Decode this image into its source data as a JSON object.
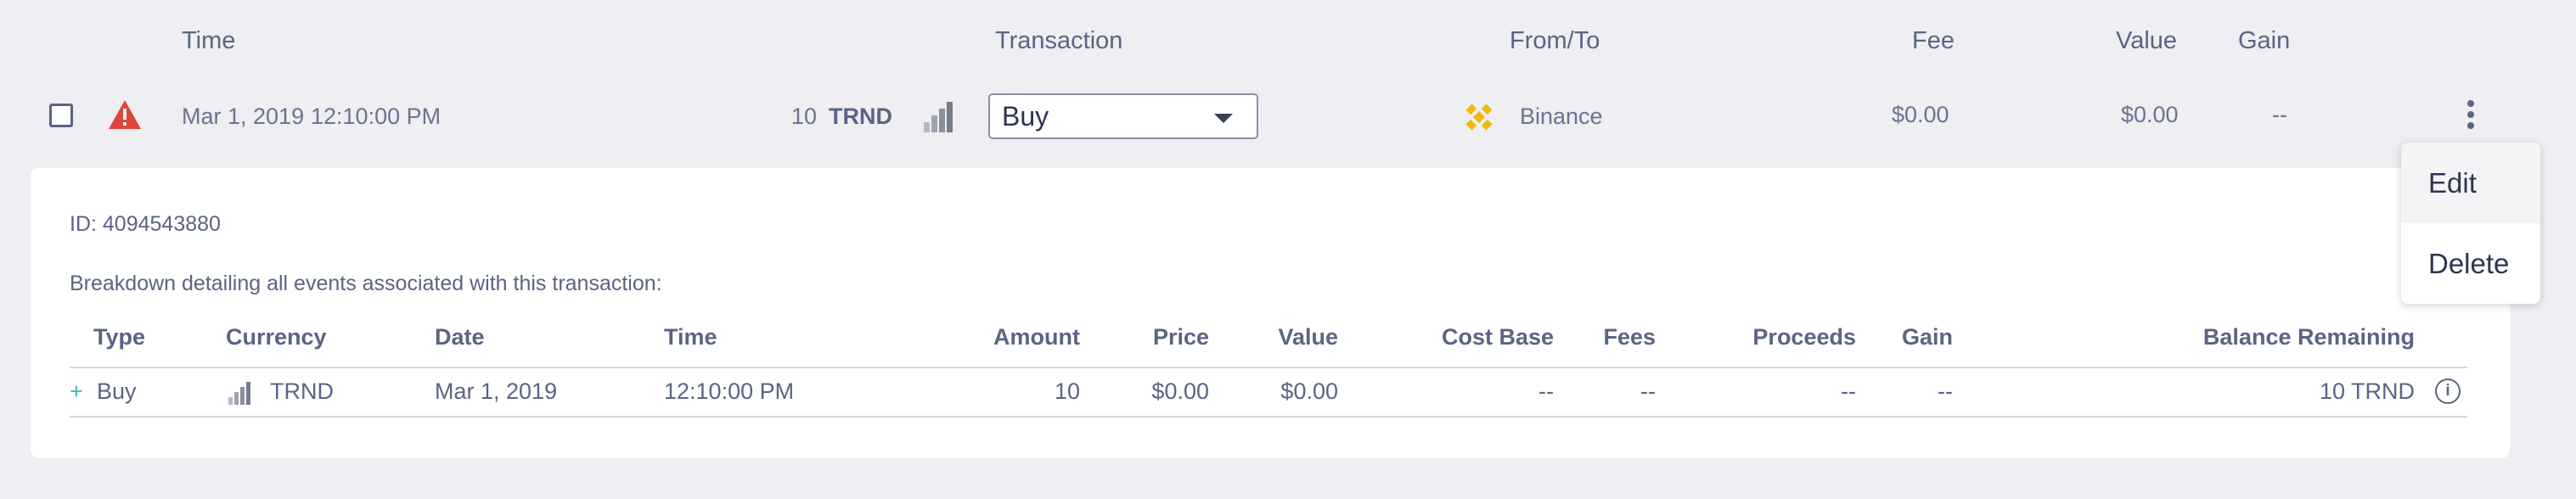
{
  "header": {
    "time": "Time",
    "transaction": "Transaction",
    "from_to": "From/To",
    "fee": "Fee",
    "value": "Value",
    "gain": "Gain"
  },
  "row": {
    "date": "Mar 1, 2019",
    "time": "12:10:00 PM",
    "amount": "10",
    "currency": "TRND",
    "transaction_type": "Buy",
    "exchange": "Binance",
    "fee": "$0.00",
    "value": "$0.00",
    "gain": "--"
  },
  "menu": {
    "edit": "Edit",
    "delete": "Delete"
  },
  "detail": {
    "id_label": "ID: 4094543880",
    "breakdown_text": "Breakdown detailing all events associated with this transaction:",
    "columns": [
      "Type",
      "Currency",
      "Date",
      "Time",
      "Amount",
      "Price",
      "Value",
      "Cost Base",
      "Fees",
      "Proceeds",
      "Gain",
      "Balance Remaining"
    ],
    "rows": [
      {
        "sign": "+",
        "type": "Buy",
        "currency": "TRND",
        "date": "Mar 1, 2019",
        "time": "12:10:00 PM",
        "amount": "10",
        "price": "$0.00",
        "value": "$0.00",
        "cost_base": "--",
        "fees": "--",
        "proceeds": "--",
        "gain": "--",
        "balance_remaining": "10 TRND"
      }
    ]
  },
  "colors": {
    "background": "#eeeef3",
    "panel": "#ffffff",
    "text": "#5b6483",
    "warning": "#e0453a",
    "binance": "#f0b90b",
    "plus": "#3cbfae"
  },
  "icons": {
    "warning": "warning-icon",
    "coin": "trnd-coin-icon",
    "exchange": "binance-icon",
    "more": "kebab-menu-icon",
    "info": "info-icon"
  }
}
